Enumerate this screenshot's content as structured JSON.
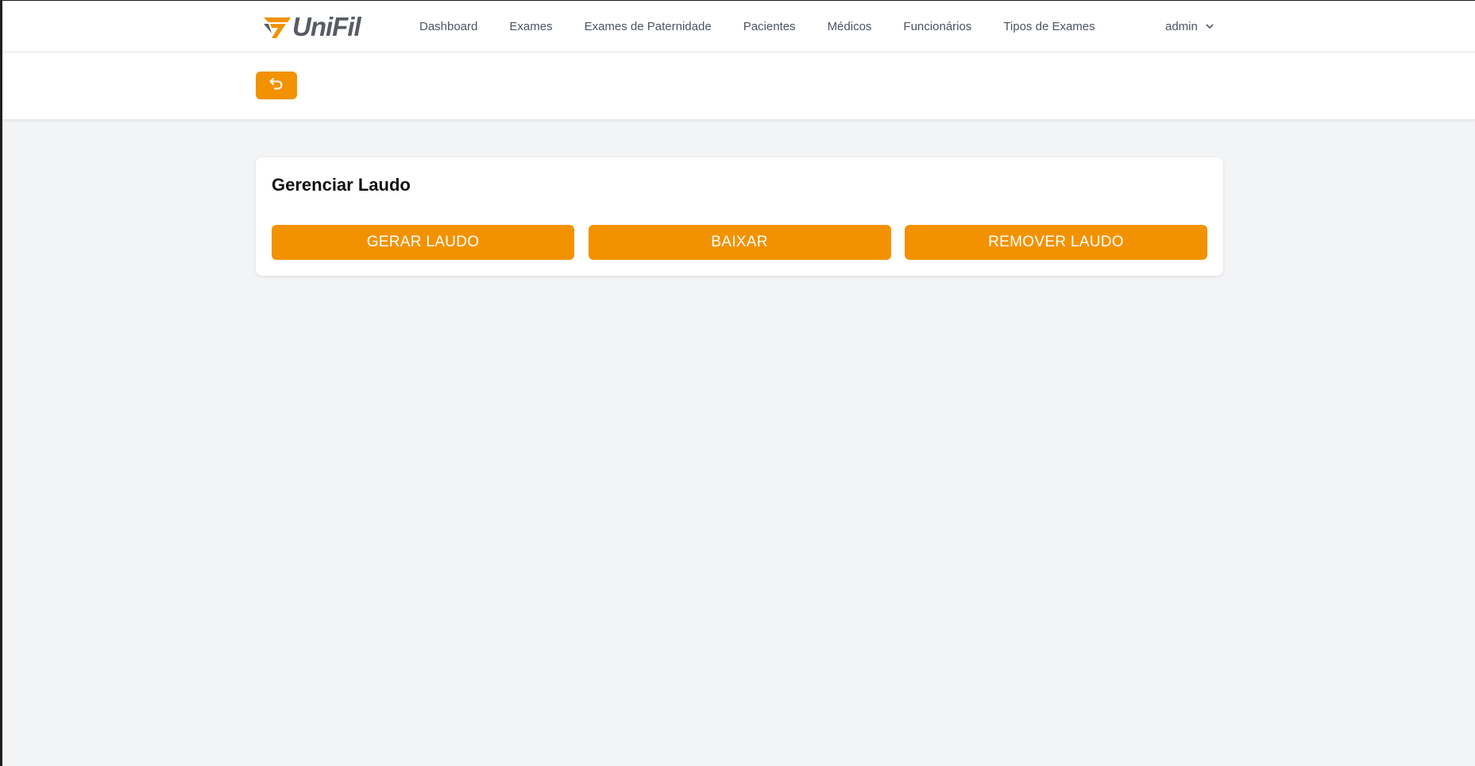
{
  "brand": {
    "logo_text": "UniFil",
    "accent_color": "#f29200",
    "logo_text_color": "#575b63"
  },
  "nav": {
    "items": [
      {
        "label": "Dashboard"
      },
      {
        "label": "Exames"
      },
      {
        "label": "Exames de Paternidade"
      },
      {
        "label": "Pacientes"
      },
      {
        "label": "Médicos"
      },
      {
        "label": "Funcionários"
      },
      {
        "label": "Tipos de Exames"
      }
    ],
    "user_label": "admin",
    "user_icon": "chevron-down-icon"
  },
  "subheader": {
    "back_icon": "undo-arrow-icon"
  },
  "card": {
    "title": "Gerenciar Laudo",
    "buttons": {
      "generate": "GERAR LAUDO",
      "download": "BAIXAR",
      "remove": "REMOVER LAUDO"
    }
  }
}
